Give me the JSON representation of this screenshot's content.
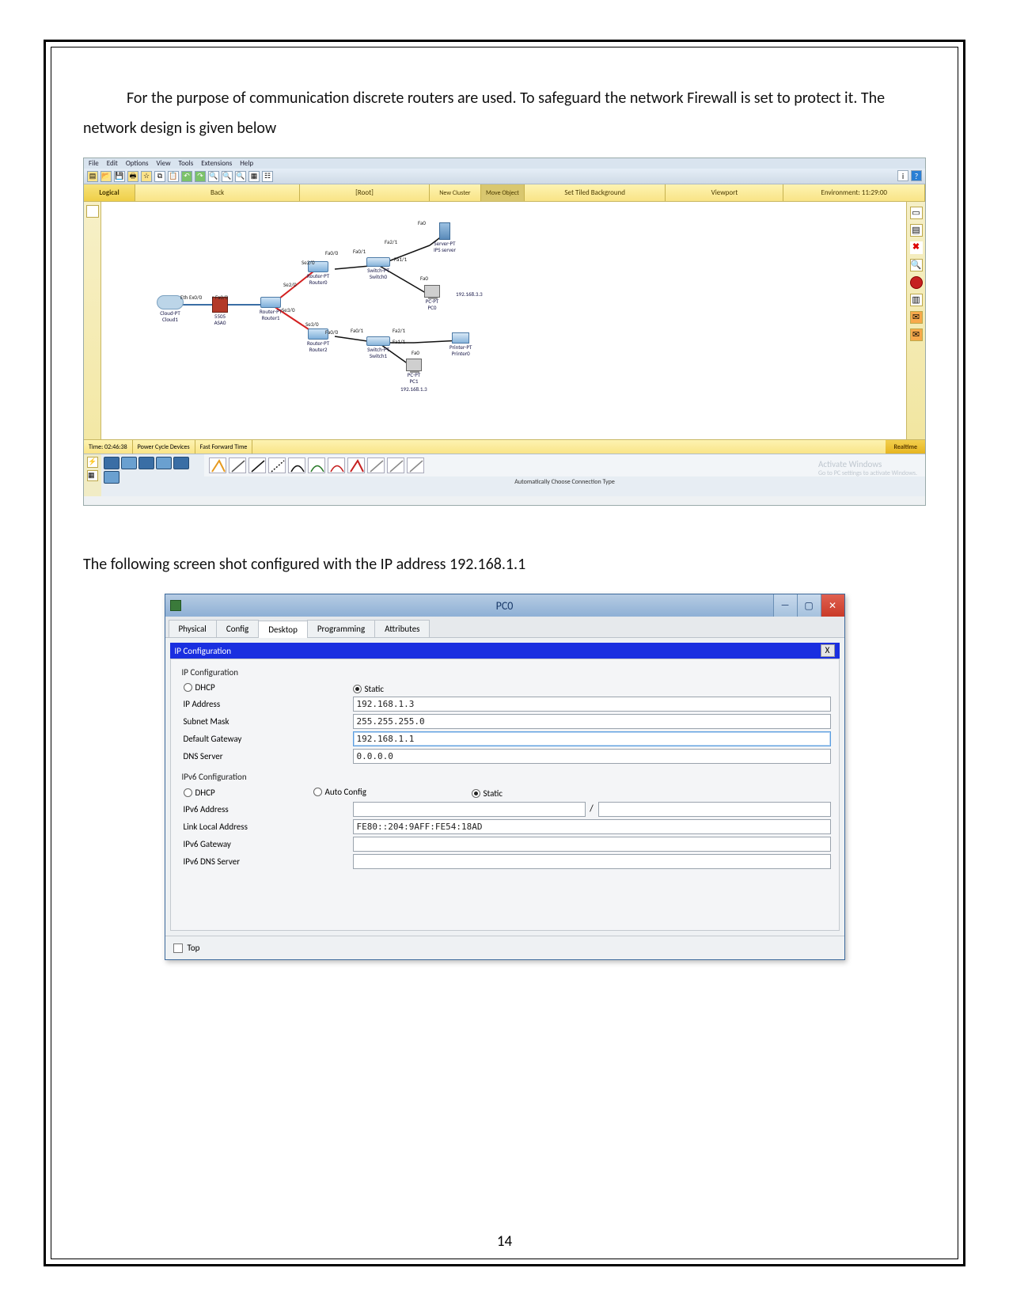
{
  "doc": {
    "para1": "For the purpose of communication discrete routers are used. To safeguard the network Firewall is set to protect it. The network design is given below",
    "para2": "The following screen shot configured with the IP address 192.168.1.1",
    "page_number": "14"
  },
  "pt": {
    "menu": [
      "File",
      "Edit",
      "Options",
      "View",
      "Tools",
      "Extensions",
      "Help"
    ],
    "tabs": {
      "logical": "Logical",
      "back": "Back",
      "root": "[Root]",
      "new_cluster": "New Cluster",
      "move_object": "Move Object",
      "set_tiled": "Set Tiled Background",
      "viewport": "Viewport",
      "environment": "Environment: 11:29:00"
    },
    "status": {
      "time": "Time: 02:46:38",
      "power": "Power Cycle Devices",
      "fast": "Fast Forward Time",
      "realtime": "Realtime"
    },
    "bottom_label": "Automatically Choose Connection Type",
    "activate": {
      "l1": "Activate Windows",
      "l2": "Go to PC settings to activate Windows."
    },
    "nodes": {
      "cloud": "Cloud-PT\nCloud1",
      "asa": "5505\nASA0",
      "r1": "Router-PT\nRouter1",
      "r0": "Router-PT\nRouter0",
      "r2": "Router-PT\nRouter2",
      "sw0": "Switch-PT\nSwitch0",
      "sw1": "Switch-PT\nSwitch1",
      "srv": "Server-PT\nIPS server",
      "pc0": "PC-PT\nPC0",
      "pc1": "PC-PT\nPC1",
      "pr": "Printer-PT\nPrinter0",
      "ip_pc0": "192.168.3.3",
      "ip_pc1": "192.168.1.3"
    },
    "ifaces": {
      "eth": "Eth Ex0/0",
      "rfa00": "r Fa0/0",
      "se20_a": "Se2/0",
      "se20_b": "Se2/0",
      "se30": "Se3/0",
      "se30b": "Se3/0",
      "fa00a": "Fa0/0",
      "fa00b": "Fa0/0",
      "fa01a": "Fa0/1",
      "fa01b": "Fa0/1",
      "fa11a": "Fa1/1",
      "fa11b": "Fa1/1",
      "fa21a": "Fa2/1",
      "fa21b": "Fa2/1",
      "fa0": "Fa0"
    }
  },
  "pc0": {
    "title": "PC0",
    "tabs": [
      "Physical",
      "Config",
      "Desktop",
      "Programming",
      "Attributes"
    ],
    "active_tab": "Desktop",
    "app_title": "IP Configuration",
    "close_x": "X",
    "ipcfg": {
      "heading": "IP Configuration",
      "mode_dhcp": "DHCP",
      "mode_static": "Static",
      "ip_label": "IP Address",
      "ip": "192.168.1.3",
      "mask_label": "Subnet Mask",
      "mask": "255.255.255.0",
      "gw_label": "Default Gateway",
      "gw": "192.168.1.1",
      "dns_label": "DNS Server",
      "dns": "0.0.0.0"
    },
    "ipv6": {
      "heading": "IPv6 Configuration",
      "mode_dhcp": "DHCP",
      "mode_auto": "Auto Config",
      "mode_static": "Static",
      "addr_label": "IPv6 Address",
      "addr": "",
      "ll_label": "Link Local Address",
      "ll": "FE80::204:9AFF:FE54:18AD",
      "gw_label": "IPv6 Gateway",
      "gw": "",
      "dns_label": "IPv6 DNS Server",
      "dns": ""
    },
    "footer_top": "Top"
  }
}
